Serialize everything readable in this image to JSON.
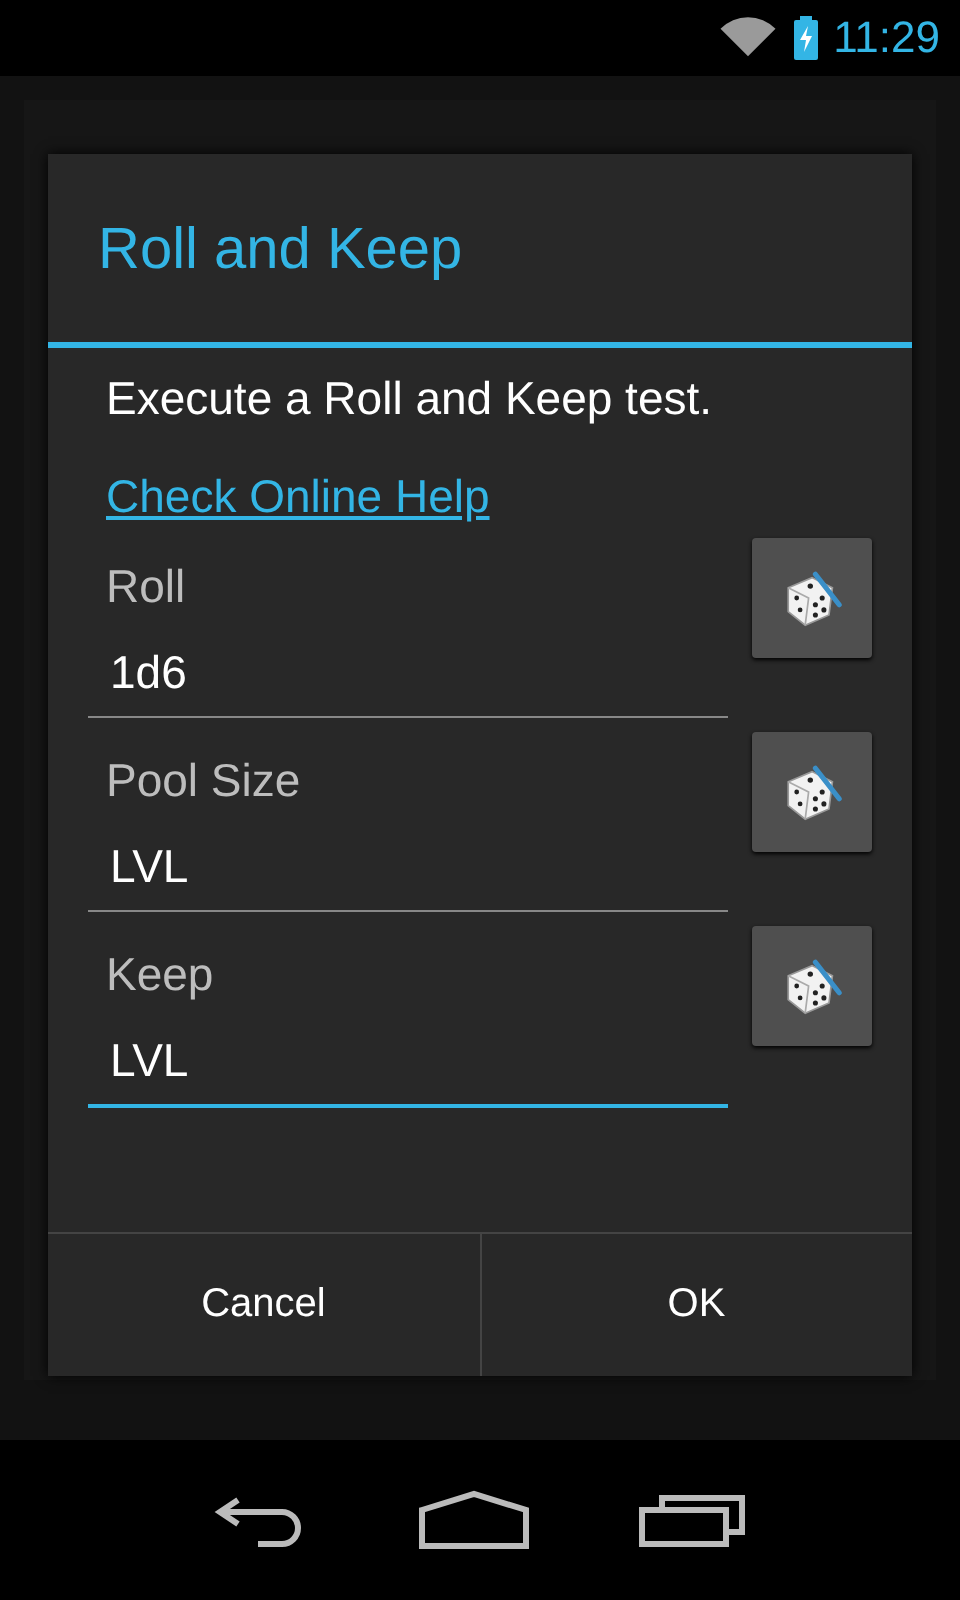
{
  "status_bar": {
    "time": "11:29"
  },
  "dialog": {
    "title": "Roll and Keep",
    "message": "Execute a Roll and Keep test.",
    "help_link": "Check Online Help",
    "fields": [
      {
        "label": "Roll",
        "value": "1d6",
        "focused": false
      },
      {
        "label": "Pool Size",
        "value": "LVL",
        "focused": false
      },
      {
        "label": "Keep",
        "value": "LVL",
        "focused": true
      }
    ],
    "buttons": [
      "Cancel",
      "OK"
    ]
  }
}
